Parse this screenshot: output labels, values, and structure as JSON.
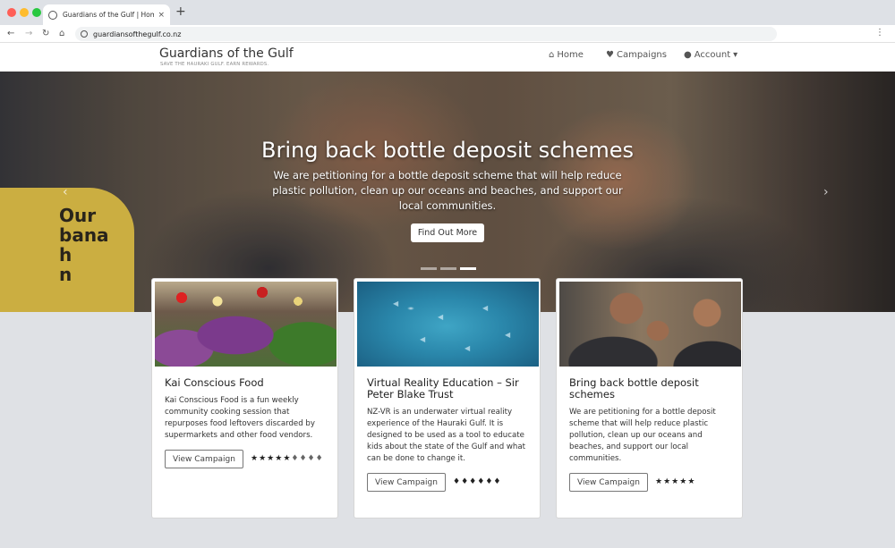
{
  "browser": {
    "tab_title": "Guardians of the Gulf | Home",
    "tab_close": "×",
    "new_tab": "+",
    "url": "guardiansofthegulf.co.nz",
    "back": "←",
    "forward": "→",
    "reload": "↻",
    "home": "⌂",
    "menu": "⋮"
  },
  "site": {
    "brand_title": "Guardians of the Gulf",
    "brand_subtitle": "SAVE THE HAURAKI GULF. EARN REWARDS.",
    "nav": {
      "home": "Home",
      "campaigns": "Campaigns",
      "account": "Account",
      "account_caret": "▾",
      "home_icon": "⌂",
      "campaigns_icon": "♥",
      "account_icon": "●"
    }
  },
  "hero": {
    "title": "Bring back bottle deposit schemes",
    "text": "We are petitioning for a bottle deposit scheme that will help reduce plastic pollution, clean up our oceans and beaches, and support our local communities.",
    "button": "Find Out More",
    "banana_text": "Our\nbana\nh\nn",
    "prev": "‹",
    "next": "›",
    "active_slide": 3,
    "slide_count": 3
  },
  "cards": [
    {
      "title": "Kai Conscious Food",
      "text": "Kai Conscious Food is a fun weekly community cooking session that repurposes food leftovers discarded by supermarkets and other food vendors.",
      "button": "View Campaign",
      "rating_icons": [
        "★",
        "★",
        "★",
        "★",
        "★",
        "♦",
        "♦",
        "♦",
        "♦"
      ]
    },
    {
      "title": "Virtual Reality Education – Sir Peter Blake Trust",
      "text": "NZ-VR is an underwater virtual reality experience of the Hauraki Gulf. It is designed to be used as a tool to educate kids about the state of the Gulf and what can be done to change it.",
      "button": "View Campaign",
      "rating_icons": [
        "♦",
        "♦",
        "♦",
        "♦",
        "♦",
        "♦"
      ]
    },
    {
      "title": "Bring back bottle deposit schemes",
      "text": "We are petitioning for a bottle deposit scheme that will help reduce plastic pollution, clean up our oceans and beaches, and support our local communities.",
      "button": "View Campaign",
      "rating_icons": [
        "★",
        "★",
        "★",
        "★",
        "★"
      ]
    }
  ],
  "colors": {
    "page_bg": "#dfe1e5",
    "nav_bg": "#ffffff",
    "hero_text": "#ffffff"
  }
}
